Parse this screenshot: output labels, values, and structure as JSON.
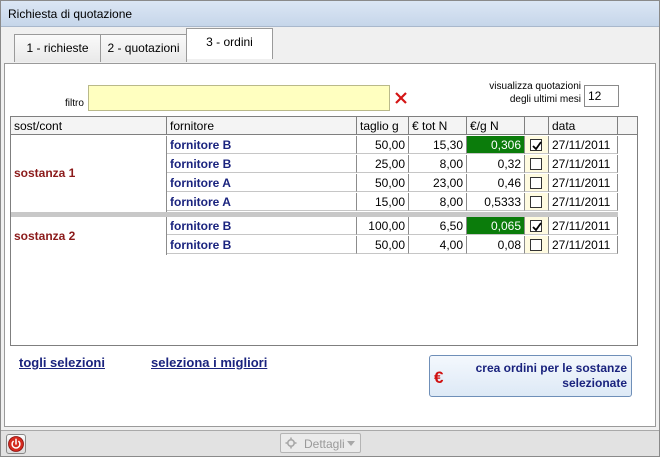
{
  "window": {
    "title": "Richiesta di quotazione"
  },
  "tabs": [
    {
      "label": "1 - richieste"
    },
    {
      "label": "2 - quotazioni"
    },
    {
      "label": "3 - ordini"
    }
  ],
  "filter": {
    "label": "filtro",
    "value": ""
  },
  "months": {
    "label_line1": "visualizza quotazioni",
    "label_line2": "degli ultimi mesi",
    "value": "12"
  },
  "table": {
    "columns": [
      "sost/cont",
      "fornitore",
      "taglio g",
      "€ tot N",
      "€/g N",
      "",
      "data"
    ],
    "groups": [
      {
        "name": "sostanza 1",
        "rows": [
          {
            "supplier": "fornitore B",
            "size": "50,00",
            "total": "15,30",
            "per_g": "0,306",
            "checked": true,
            "best": true,
            "date": "27/11/2011"
          },
          {
            "supplier": "fornitore B",
            "size": "25,00",
            "total": "8,00",
            "per_g": "0,32",
            "checked": false,
            "best": false,
            "date": "27/11/2011"
          },
          {
            "supplier": "fornitore A",
            "size": "50,00",
            "total": "23,00",
            "per_g": "0,46",
            "checked": false,
            "best": false,
            "date": "27/11/2011"
          },
          {
            "supplier": "fornitore A",
            "size": "15,00",
            "total": "8,00",
            "per_g": "0,5333",
            "checked": false,
            "best": false,
            "date": "27/11/2011"
          }
        ]
      },
      {
        "name": "sostanza 2",
        "rows": [
          {
            "supplier": "fornitore B",
            "size": "100,00",
            "total": "6,50",
            "per_g": "0,065",
            "checked": true,
            "best": true,
            "date": "27/11/2011"
          },
          {
            "supplier": "fornitore B",
            "size": "50,00",
            "total": "4,00",
            "per_g": "0,08",
            "checked": false,
            "best": false,
            "date": "27/11/2011"
          }
        ]
      }
    ]
  },
  "actions": {
    "clear_selection": "togli selezioni",
    "select_best": "seleziona i migliori",
    "create_orders_line1": "crea ordini per le sostanze",
    "create_orders_line2": "selezionate"
  },
  "statusbar": {
    "details_label": "Dettagli"
  },
  "colors": {
    "best_highlight": "#0b7c0b",
    "supplier_text": "#1a237e",
    "substance_text": "#8b1a1a",
    "filter_bg": "#ffffc0"
  },
  "icons": {
    "clear_filter": "x-icon",
    "power": "power-icon",
    "details": "gear-icon",
    "details_dropdown": "chevron-down-icon",
    "create_orders": "euro-icon"
  }
}
